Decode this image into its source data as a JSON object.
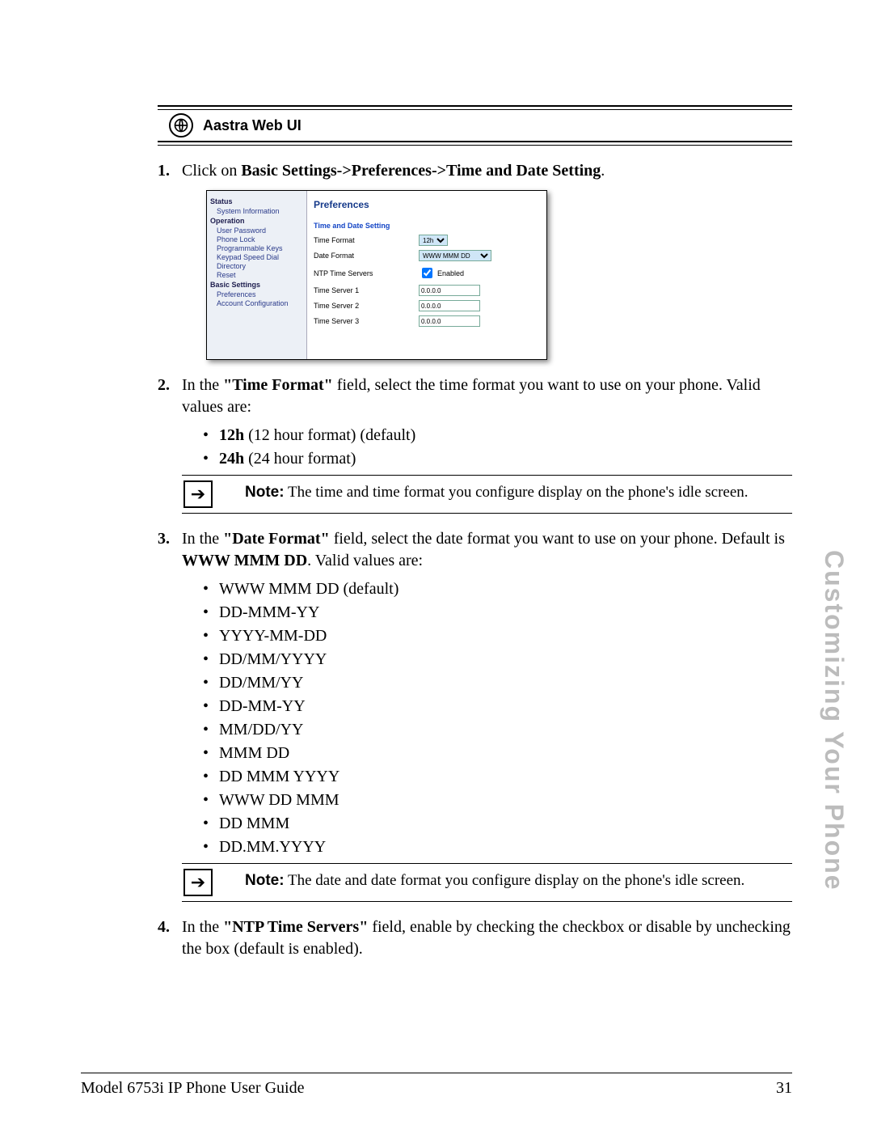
{
  "banner": {
    "title": "Aastra Web UI"
  },
  "steps": {
    "s1": {
      "num": "1.",
      "pre": "Click on ",
      "bold": "Basic Settings->Preferences->Time and Date Setting",
      "post": "."
    },
    "s2": {
      "num": "2.",
      "pre": "In the ",
      "bold1": "\"Time Format\"",
      "mid": " field, select the time format you want to use on your phone. Valid values are:",
      "opt1_b": "12h",
      "opt1_t": " (12 hour format) (default)",
      "opt2_b": "24h",
      "opt2_t": " (24 hour format)"
    },
    "s3": {
      "num": "3.",
      "pre": "In the ",
      "bold1": "\"Date Format\"",
      "mid1": " field, select the date format you want to use on your phone. Default is ",
      "bold2": "WWW MMM DD",
      "mid2": ". Valid values are:",
      "opts": [
        "WWW MMM DD (default)",
        "DD-MMM-YY",
        "YYYY-MM-DD",
        "DD/MM/YYYY",
        "DD/MM/YY",
        "DD-MM-YY",
        "MM/DD/YY",
        "MMM DD",
        "DD MMM YYYY",
        "WWW DD MMM",
        "DD MMM",
        "DD.MM.YYYY"
      ]
    },
    "s4": {
      "num": "4.",
      "pre": "In the ",
      "bold1": "\"NTP Time Servers\"",
      "post": " field, enable by checking the checkbox or disable by unchecking the box (default is enabled)."
    }
  },
  "notes": {
    "label": "Note:",
    "n1": " The time and time format you configure display on the phone's idle screen.",
    "n2": " The date and date format you configure display on the phone's idle screen."
  },
  "webui": {
    "side": {
      "sec1": "Status",
      "sec1_items": [
        "System Information"
      ],
      "sec2": "Operation",
      "sec2_items": [
        "User Password",
        "Phone Lock",
        "Programmable Keys",
        "Keypad Speed Dial",
        "Directory",
        "Reset"
      ],
      "sec3": "Basic Settings",
      "sec3_items": [
        "Preferences",
        "Account Configuration"
      ]
    },
    "main": {
      "heading": "Preferences",
      "subheading": "Time and Date Setting",
      "rows": {
        "time_format": {
          "label": "Time Format",
          "value": "12h"
        },
        "date_format": {
          "label": "Date Format",
          "value": "WWW MMM DD"
        },
        "ntp": {
          "label": "NTP Time Servers",
          "checked": true,
          "text": "Enabled"
        },
        "ts1": {
          "label": "Time Server 1",
          "value": "0.0.0.0"
        },
        "ts2": {
          "label": "Time Server 2",
          "value": "0.0.0.0"
        },
        "ts3": {
          "label": "Time Server 3",
          "value": "0.0.0.0"
        }
      }
    }
  },
  "side_title": "Customizing Your Phone",
  "footer": {
    "left": "Model 6753i IP Phone User Guide",
    "right": "31"
  }
}
